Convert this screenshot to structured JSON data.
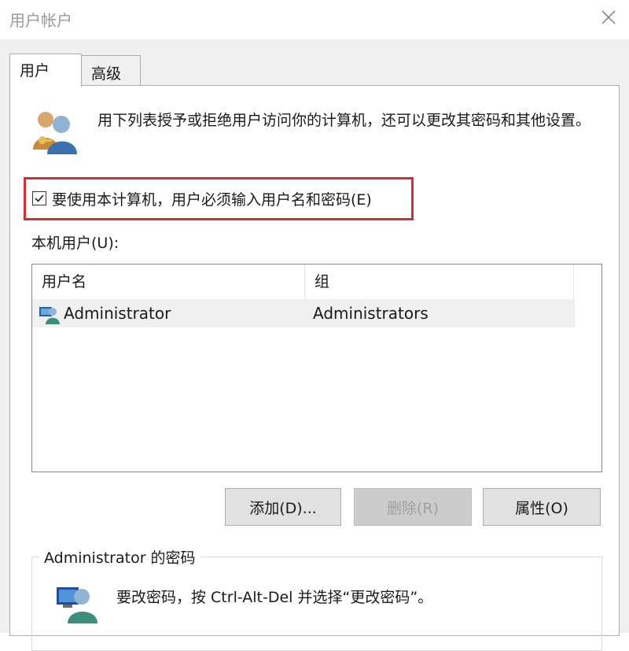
{
  "window": {
    "title": "用户帐户"
  },
  "tabs": [
    {
      "label": "用户"
    },
    {
      "label": "高级"
    }
  ],
  "description": "用下列表授予或拒绝用户访问你的计算机，还可以更改其密码和其他设置。",
  "require_login": {
    "label": "要使用本计算机，用户必须输入用户名和密码(E)",
    "checked": true,
    "highlight_color": "#d32f2f"
  },
  "local_users": {
    "label": "本机用户(U):",
    "columns": [
      "用户名",
      "组"
    ],
    "rows": [
      {
        "user": "Administrator",
        "group": "Administrators"
      }
    ]
  },
  "buttons": {
    "add": "添加(D)...",
    "remove": "删除(R)",
    "properties": "属性(O)"
  },
  "password_group": {
    "title": "Administrator 的密码",
    "text": "要改密码，按 Ctrl-Alt-Del 并选择“更改密码”。"
  },
  "icons": {
    "close": "close-icon",
    "users": "users-icon",
    "user_row": "user-icon",
    "password": "user-password-icon"
  }
}
